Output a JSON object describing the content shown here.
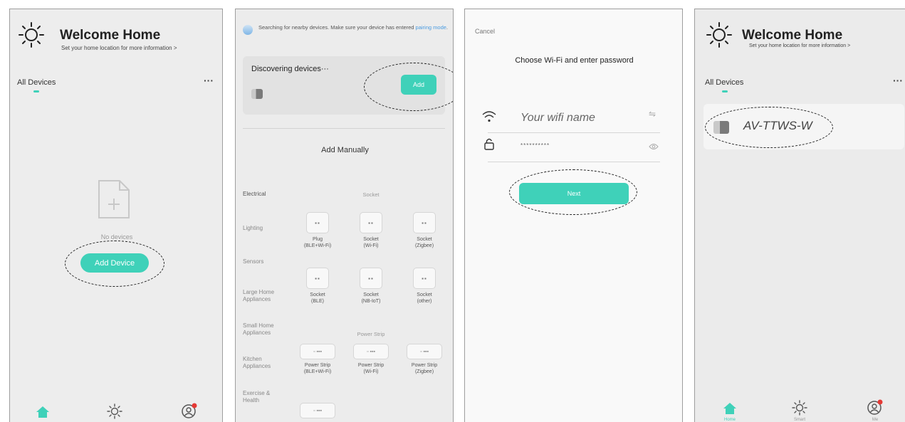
{
  "colors": {
    "accent": "#3fd1b9",
    "badge": "#e53935"
  },
  "s1": {
    "welcome_title": "Welcome Home",
    "welcome_sub": "Set your home location for more information >",
    "all_devices": "All Devices",
    "more": "···",
    "no_devices": "No devices",
    "add_device": "Add Device",
    "nav": [
      {
        "icon": "home-icon",
        "label": ""
      },
      {
        "icon": "smart-sun-icon",
        "label": ""
      },
      {
        "icon": "profile-icon",
        "label": ""
      }
    ]
  },
  "s2": {
    "searching": "Searching for nearby devices. Make sure your device has entered",
    "pairing_link": "pairing mode",
    "searching_tail": ".",
    "discovering": "Discovering devices···",
    "add": "Add",
    "add_manually": "Add Manually",
    "categories": [
      "Electrical",
      "Lighting",
      "Sensors",
      "Large Home Appliances",
      "Small Home Appliances",
      "Kitchen Appliances",
      "Exercise & Health"
    ],
    "section_socket": "Socket",
    "section_power_strip": "Power Strip",
    "socket_products": [
      {
        "name": "Plug",
        "sub": "(BLE+Wi-Fi)"
      },
      {
        "name": "Socket",
        "sub": "(Wi-Fi)"
      },
      {
        "name": "Socket",
        "sub": "(Zigbee)"
      },
      {
        "name": "Socket",
        "sub": "(BLE)"
      },
      {
        "name": "Socket",
        "sub": "(NB-IoT)"
      },
      {
        "name": "Socket",
        "sub": "(other)"
      }
    ],
    "strip_products": [
      {
        "name": "Power Strip",
        "sub": "(BLE+Wi-Fi)"
      },
      {
        "name": "Power Strip",
        "sub": "(Wi-Fi)"
      },
      {
        "name": "Power Strip",
        "sub": "(Zigbee)"
      }
    ]
  },
  "s3": {
    "cancel": "Cancel",
    "title": "Choose Wi-Fi and enter password",
    "wifi_placeholder": "Your wifi name",
    "password_mask": "**********",
    "next": "Next"
  },
  "s4": {
    "welcome_title": "Welcome Home",
    "welcome_sub": "Set your home location for more information >",
    "all_devices": "All Devices",
    "more": "···",
    "device_name": "AV-TTWS-W",
    "nav": [
      {
        "icon": "home-icon",
        "label": "Home"
      },
      {
        "icon": "smart-sun-icon",
        "label": "Smart"
      },
      {
        "icon": "profile-icon",
        "label": "Me"
      }
    ]
  }
}
